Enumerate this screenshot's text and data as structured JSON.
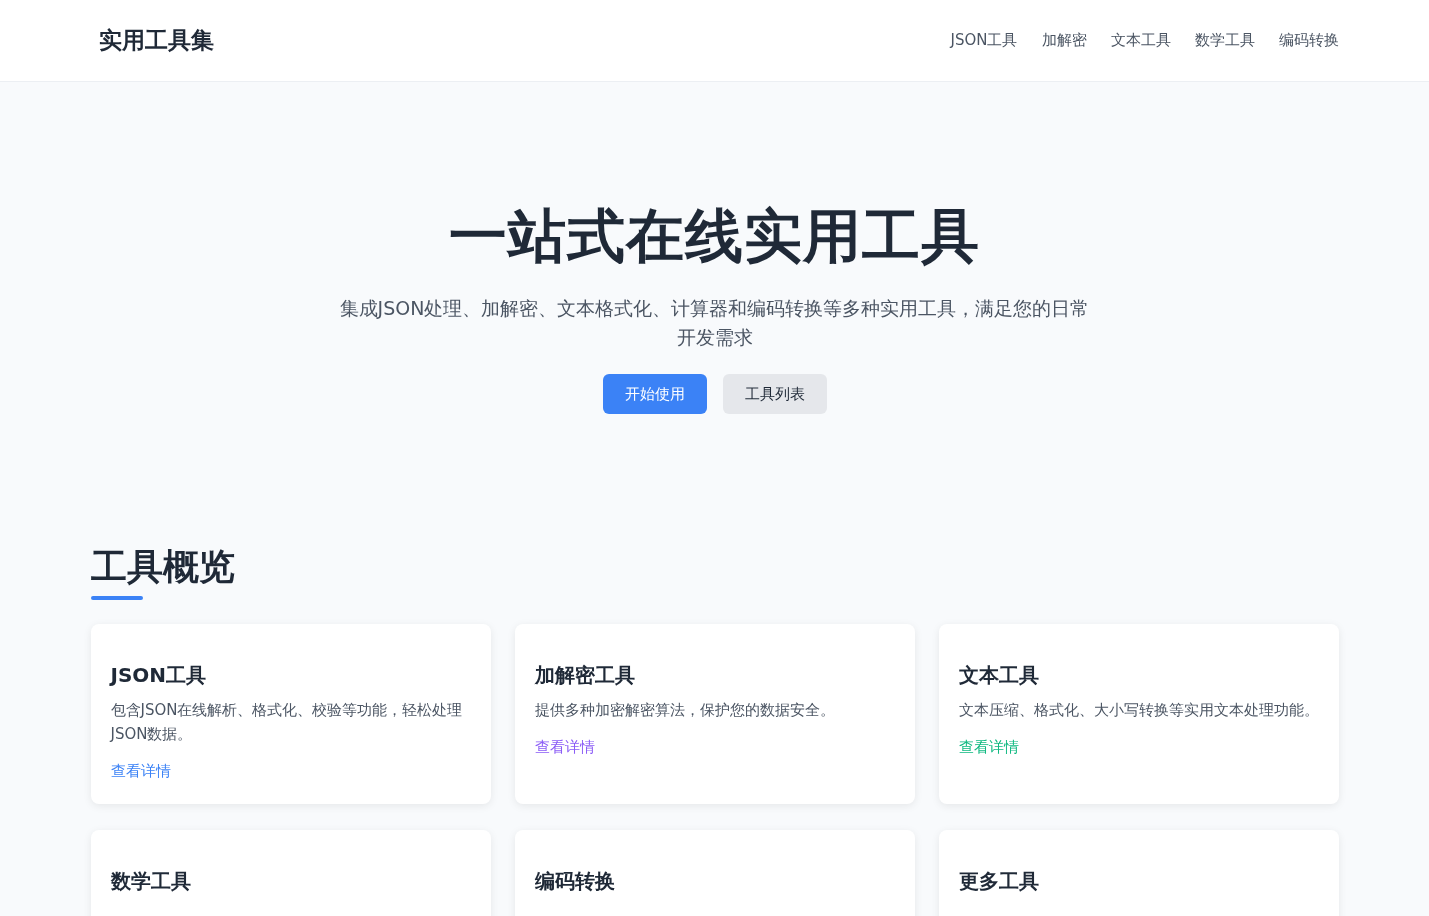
{
  "brand": "实用工具集",
  "nav": [
    {
      "label": "JSON工具"
    },
    {
      "label": "加解密"
    },
    {
      "label": "文本工具"
    },
    {
      "label": "数学工具"
    },
    {
      "label": "编码转换"
    }
  ],
  "hero": {
    "title": "一站式在线实用工具",
    "subtitle": "集成JSON处理、加解密、文本格式化、计算器和编码转换等多种实用工具，满足您的日常开发需求",
    "buttons": [
      {
        "label": "开始使用",
        "kind": "primary"
      },
      {
        "label": "工具列表",
        "kind": "secondary"
      }
    ]
  },
  "section_title": "工具概览",
  "cards": [
    {
      "title": "JSON工具",
      "description": "包含JSON在线解析、格式化、校验等功能，轻松处理JSON数据。",
      "link": "查看详情",
      "color": "#3b82f6"
    },
    {
      "title": "加解密工具",
      "description": "提供多种加密解密算法，保护您的数据安全。",
      "link": "查看详情",
      "color": "#8b5cf6"
    },
    {
      "title": "文本工具",
      "description": "文本压缩、格式化、大小写转换等实用文本处理功能。",
      "link": "查看详情",
      "color": "#10b981"
    },
    {
      "title": "数学工具"
    },
    {
      "title": "编码转换"
    },
    {
      "title": "更多工具"
    }
  ]
}
